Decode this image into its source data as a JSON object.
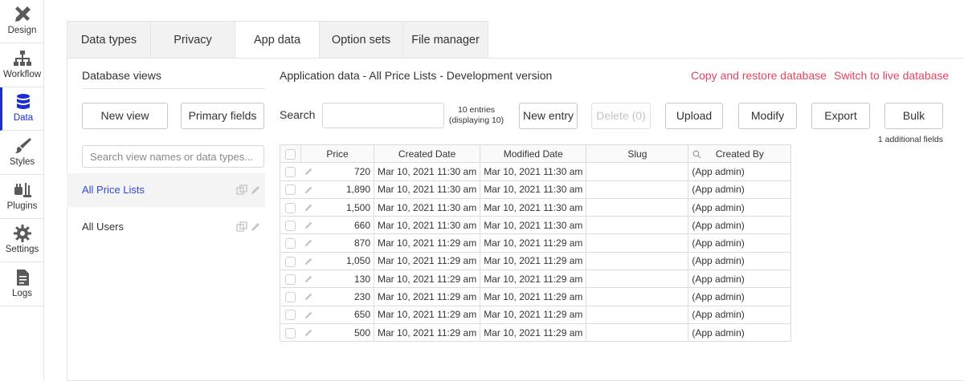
{
  "sidebar": {
    "items": [
      {
        "label": "Design",
        "icon": "design-icon"
      },
      {
        "label": "Workflow",
        "icon": "workflow-icon"
      },
      {
        "label": "Data",
        "icon": "database-icon",
        "active": true
      },
      {
        "label": "Styles",
        "icon": "brush-icon"
      },
      {
        "label": "Plugins",
        "icon": "plug-icon"
      },
      {
        "label": "Settings",
        "icon": "gear-icon"
      },
      {
        "label": "Logs",
        "icon": "document-icon"
      }
    ]
  },
  "tabs": [
    {
      "label": "Data types"
    },
    {
      "label": "Privacy"
    },
    {
      "label": "App data",
      "active": true
    },
    {
      "label": "Option sets"
    },
    {
      "label": "File manager"
    }
  ],
  "views": {
    "title": "Database views",
    "new_view_label": "New view",
    "primary_fields_label": "Primary fields",
    "search_placeholder": "Search view names or data types...",
    "items": [
      {
        "label": "All Price Lists",
        "active": true
      },
      {
        "label": "All Users"
      }
    ]
  },
  "main": {
    "title": "Application data - All Price Lists - Development version",
    "copy_restore_label": "Copy and restore database",
    "switch_live_label": "Switch to live database",
    "search_label": "Search",
    "entries_line1": "10 entries",
    "entries_line2": "(displaying 10)",
    "buttons": {
      "new_entry": "New entry",
      "delete": "Delete (0)",
      "upload": "Upload",
      "modify": "Modify",
      "export": "Export",
      "bulk": "Bulk"
    },
    "additional_fields": "1 additional fields"
  },
  "table": {
    "headers": [
      "Price",
      "Created Date",
      "Modified Date",
      "Slug",
      "Created By"
    ],
    "rows": [
      [
        "720",
        "Mar 10, 2021 11:30 am",
        "Mar 10, 2021 11:30 am",
        "",
        "(App admin)"
      ],
      [
        "1,890",
        "Mar 10, 2021 11:30 am",
        "Mar 10, 2021 11:30 am",
        "",
        "(App admin)"
      ],
      [
        "1,500",
        "Mar 10, 2021 11:30 am",
        "Mar 10, 2021 11:30 am",
        "",
        "(App admin)"
      ],
      [
        "660",
        "Mar 10, 2021 11:30 am",
        "Mar 10, 2021 11:30 am",
        "",
        "(App admin)"
      ],
      [
        "870",
        "Mar 10, 2021 11:29 am",
        "Mar 10, 2021 11:29 am",
        "",
        "(App admin)"
      ],
      [
        "1,050",
        "Mar 10, 2021 11:29 am",
        "Mar 10, 2021 11:29 am",
        "",
        "(App admin)"
      ],
      [
        "130",
        "Mar 10, 2021 11:29 am",
        "Mar 10, 2021 11:29 am",
        "",
        "(App admin)"
      ],
      [
        "230",
        "Mar 10, 2021 11:29 am",
        "Mar 10, 2021 11:29 am",
        "",
        "(App admin)"
      ],
      [
        "650",
        "Mar 10, 2021 11:29 am",
        "Mar 10, 2021 11:29 am",
        "",
        "(App admin)"
      ],
      [
        "500",
        "Mar 10, 2021 11:29 am",
        "Mar 10, 2021 11:29 am",
        "",
        "(App admin)"
      ]
    ]
  },
  "colors": {
    "accent": "#1a2ed1",
    "link_red": "#e8435f",
    "active_view": "#2f4ad6"
  }
}
